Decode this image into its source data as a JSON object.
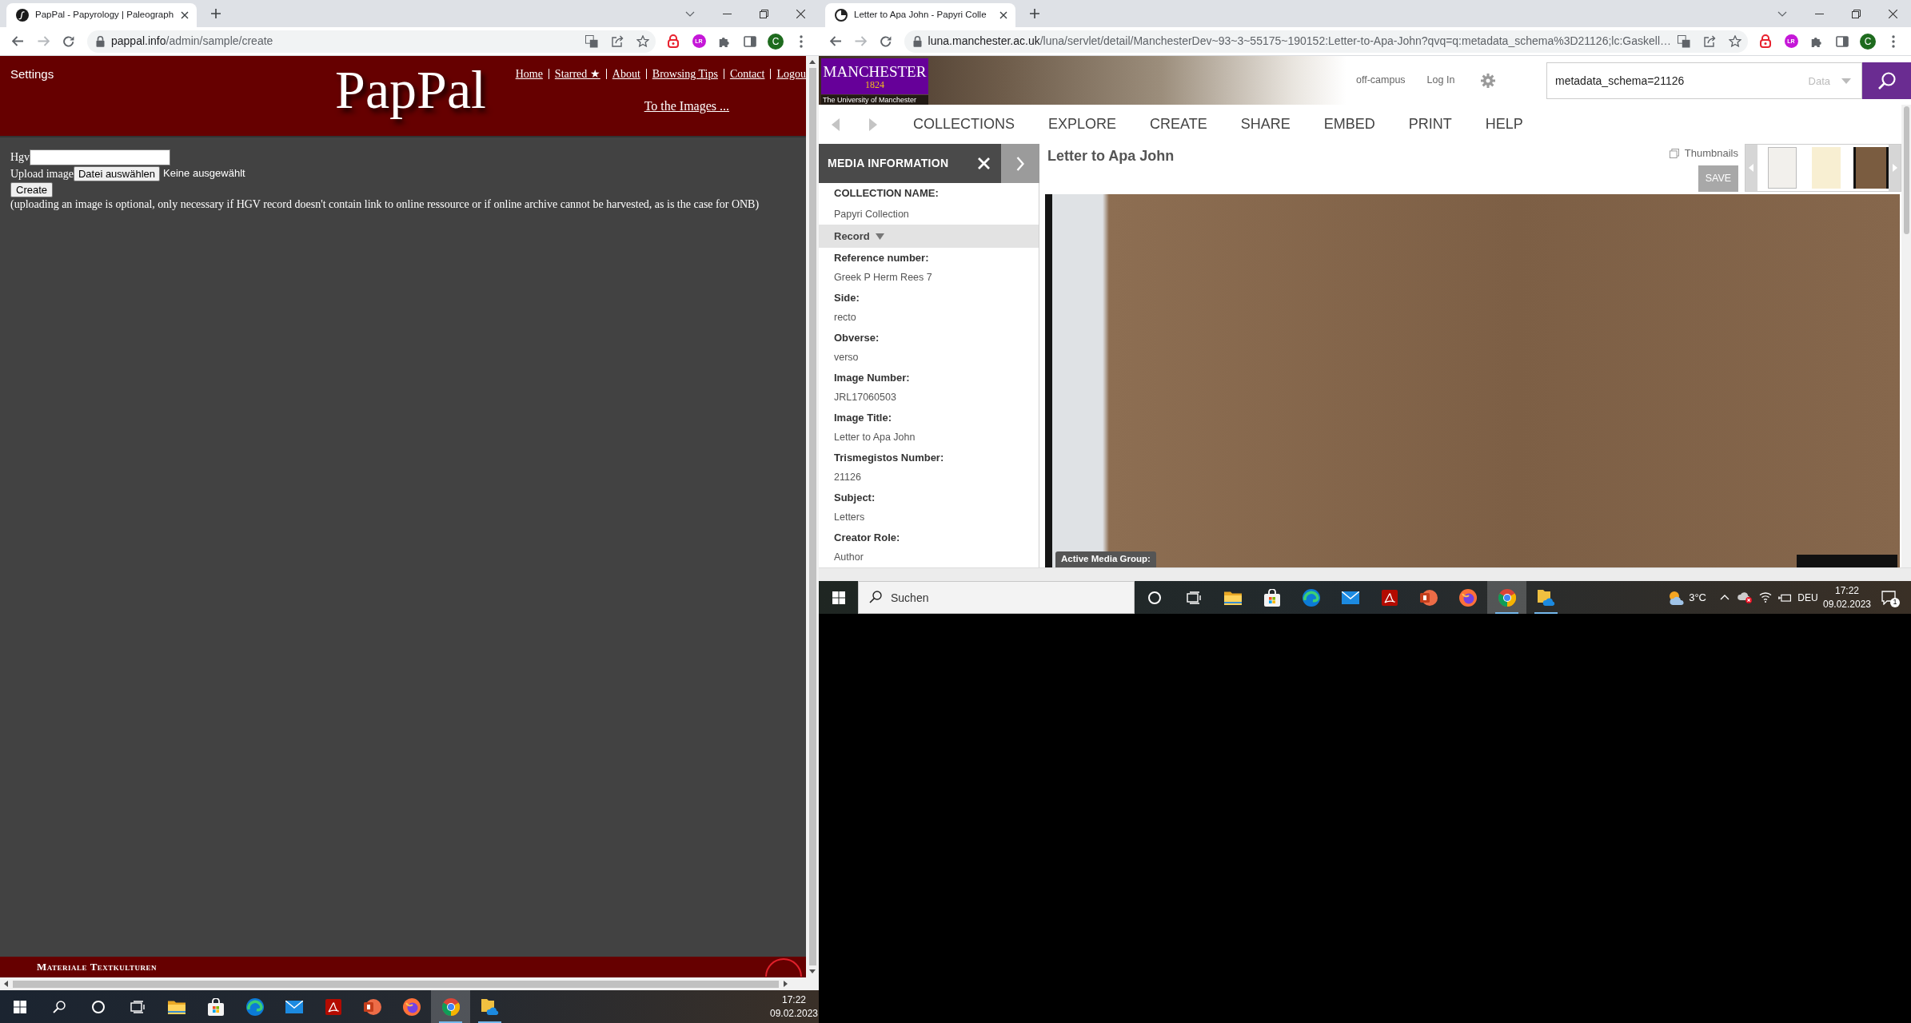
{
  "left_screen": {
    "browser": {
      "tabs": [
        {
          "title": "PapPal - Papyrology | Paleograph",
          "selected": true
        }
      ],
      "url": {
        "host": "pappal.info",
        "path": "/admin/sample/create"
      },
      "extension_badge": "LR",
      "profile": "C"
    },
    "page": {
      "settings": "Settings",
      "logo": "PapPal",
      "nav": [
        "Home",
        "Starred ★",
        "About",
        "Browsing Tips",
        "Contact",
        "Logou"
      ],
      "images_link": "To the Images ...",
      "form": {
        "hgv_label": "Hgv",
        "upload_label": "Upload image",
        "file_button": "Datei auswählen",
        "file_status": "Keine ausgewählt",
        "create_button": "Create",
        "note": "(uploading an image is optional, only necessary if HGV record doesn't contain link to online ressource or if online archive cannot be harvested, as is the case for ONB)"
      },
      "footer": "Materiale Textkulturen"
    },
    "taskbar": {
      "apps": [
        {
          "kind": "start",
          "active": false,
          "running": false
        },
        {
          "kind": "search",
          "active": false,
          "running": false
        },
        {
          "kind": "circle",
          "active": false,
          "running": false
        },
        {
          "kind": "taskview",
          "active": false,
          "running": false
        },
        {
          "kind": "folder",
          "active": false,
          "running": false
        },
        {
          "kind": "store",
          "active": false,
          "running": false
        },
        {
          "kind": "swirl",
          "active": false,
          "running": false
        },
        {
          "kind": "mail",
          "active": false,
          "running": false
        },
        {
          "kind": "pdf",
          "active": false,
          "running": false
        },
        {
          "kind": "slides",
          "active": false,
          "running": false
        },
        {
          "kind": "globe",
          "active": false,
          "running": false
        },
        {
          "kind": "browser",
          "active": true,
          "running": true
        },
        {
          "kind": "cloudfolder",
          "active": false,
          "running": true
        }
      ],
      "time": "17:22",
      "date": "09.02.2023"
    }
  },
  "right_screen": {
    "browser": {
      "tabs": [
        {
          "title": "Letter to Apa John - Papyri Colle",
          "selected": true
        }
      ],
      "url": {
        "host": "luna.manchester.ac.uk",
        "path": "/luna/servlet/detail/ManchesterDev~93~3~55175~190152:Letter-to-Apa-John?qvq=q:metadata_schema%3D21126;lc:Gaskell…"
      },
      "extension_badge": "LR",
      "profile": "C"
    },
    "page": {
      "logo": {
        "name": "MANCHESTER",
        "year": "1824",
        "caption": "The University of Manchester"
      },
      "campus": "off-campus",
      "login": "Log In",
      "search": {
        "value": "metadata_schema=21126",
        "scope": "Data"
      },
      "nav": [
        "COLLECTIONS",
        "EXPLORE",
        "CREATE",
        "SHARE",
        "EMBED",
        "PRINT",
        "HELP"
      ],
      "panel": {
        "title": "MEDIA INFORMATION",
        "fields": [
          {
            "label": "COLLECTION NAME:",
            "value": "Papyri Collection"
          }
        ],
        "section": {
          "title": "Record",
          "expanded": true
        },
        "record": [
          {
            "label": "Reference number:",
            "value": "Greek P Herm Rees 7"
          },
          {
            "label": "Side:",
            "value": "recto"
          },
          {
            "label": "Obverse:",
            "value": "verso"
          },
          {
            "label": "Image Number:",
            "value": "JRL17060503"
          },
          {
            "label": "Image Title:",
            "value": "Letter to Apa John"
          },
          {
            "label": "Trismegistos Number:",
            "value": "21126"
          },
          {
            "label": "Subject:",
            "value": "Letters"
          },
          {
            "label": "Creator Role:",
            "value": "Author"
          }
        ]
      },
      "viewer": {
        "title": "Letter to Apa John",
        "thumbnails_label": "Thumbnails",
        "save_button": "SAVE",
        "media_group_label": "Active Media Group:"
      }
    },
    "taskbar": {
      "apps": [
        {
          "kind": "start",
          "active": false,
          "running": false
        },
        {
          "kind": "searchbox",
          "placeholder": "Suchen",
          "active": false,
          "running": false
        },
        {
          "kind": "circle",
          "active": false,
          "running": false
        },
        {
          "kind": "taskview",
          "active": false,
          "running": false
        },
        {
          "kind": "folder",
          "active": false,
          "running": false
        },
        {
          "kind": "store",
          "active": false,
          "running": false
        },
        {
          "kind": "swirl",
          "active": false,
          "running": false
        },
        {
          "kind": "mail",
          "active": false,
          "running": false
        },
        {
          "kind": "pdf",
          "active": false,
          "running": false
        },
        {
          "kind": "slides",
          "active": false,
          "running": false
        },
        {
          "kind": "globe",
          "active": false,
          "running": false
        },
        {
          "kind": "browser",
          "active": true,
          "running": true
        },
        {
          "kind": "cloudfolder",
          "active": false,
          "running": true
        }
      ],
      "weather": "3°C",
      "language": "DEU",
      "time": "17:22",
      "date": "09.02.2023",
      "notifications": "1"
    }
  }
}
